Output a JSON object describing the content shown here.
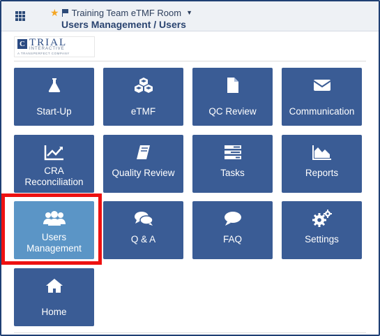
{
  "header": {
    "room_name": "Training Team eTMF Room",
    "page_title": "Users Management / Users",
    "grid_icon": "apps-grid-icon",
    "star_icon": "star-icon",
    "flag_icon": "flag-icon",
    "caret_icon": "caret-down-icon"
  },
  "logo": {
    "mark": "C",
    "name": "TRIAL",
    "sub": "INTERACTIVE",
    "tagline": "A TRANSPERFECT COMPANY"
  },
  "tiles": [
    {
      "label": "Start-Up",
      "icon": "flask-icon"
    },
    {
      "label": "eTMF",
      "icon": "cubes-icon"
    },
    {
      "label": "QC Review",
      "icon": "file-icon"
    },
    {
      "label": "Communication",
      "icon": "envelope-icon"
    },
    {
      "label": "CRA Reconciliation",
      "icon": "line-chart-icon"
    },
    {
      "label": "Quality Review",
      "icon": "book-icon"
    },
    {
      "label": "Tasks",
      "icon": "tasks-icon"
    },
    {
      "label": "Reports",
      "icon": "area-chart-icon"
    },
    {
      "label": "Users Management",
      "icon": "users-icon",
      "active": true
    },
    {
      "label": "Q & A",
      "icon": "comments-icon"
    },
    {
      "label": "FAQ",
      "icon": "comment-icon"
    },
    {
      "label": "Settings",
      "icon": "cogs-icon"
    },
    {
      "label": "Home",
      "icon": "home-icon"
    }
  ],
  "colors": {
    "tile": "#3a5c95",
    "tile_active": "#5b95c6",
    "highlight": "#ee1111",
    "frame": "#1f3f73"
  }
}
